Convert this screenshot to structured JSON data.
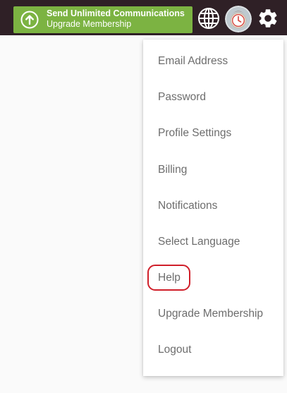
{
  "topbar": {
    "upgrade_title": "Send Unlimited Communications",
    "upgrade_subtitle": "Upgrade Membership",
    "accent": "#7cb342",
    "background": "#2f2026",
    "icons": [
      "arrow-up-circle-icon",
      "globe-icon",
      "avatar",
      "gear-icon"
    ]
  },
  "menu": {
    "items": [
      {
        "label": "Email Address"
      },
      {
        "label": "Password"
      },
      {
        "label": "Profile Settings"
      },
      {
        "label": "Billing"
      },
      {
        "label": "Notifications"
      },
      {
        "label": "Select Language"
      },
      {
        "label": "Help",
        "highlighted": true
      },
      {
        "label": "Upgrade Membership"
      },
      {
        "label": "Logout"
      }
    ],
    "highlight_color": "#d01f2a"
  }
}
